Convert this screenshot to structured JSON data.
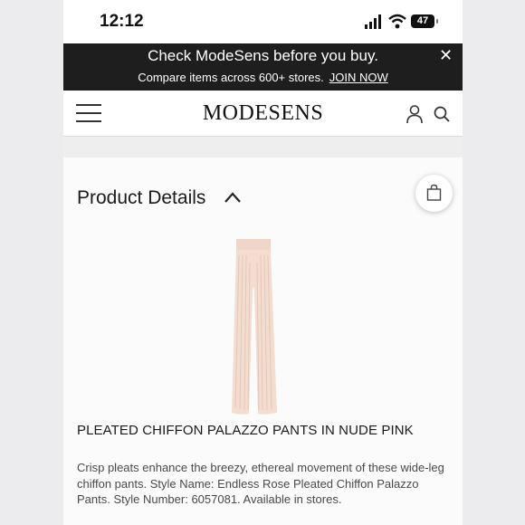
{
  "status_bar": {
    "time": "12:12",
    "battery": "47"
  },
  "promo": {
    "title": "Check ModeSens before you buy.",
    "subtitle": "Compare items across 600+ stores.",
    "link": "JOIN NOW",
    "close": "✕"
  },
  "nav": {
    "logo": "MODESENS"
  },
  "section": {
    "title": "Product Details"
  },
  "product": {
    "name": "PLEATED CHIFFON PALAZZO PANTS IN NUDE PINK",
    "description": "Crisp pleats enhance the breezy, ethereal movement of these wide-leg chiffon pants. Style Name: Endless Rose Pleated Chiffon Palazzo Pants. Style Number: 6057081. Available in stores."
  },
  "colors": {
    "promo_bg": "#1e1e1e",
    "pants_fill": "#f3ddd0",
    "text_dark": "#1a1a1a"
  },
  "icons": [
    "signal-icon",
    "wifi-icon",
    "battery-icon",
    "close-icon",
    "menu-icon",
    "user-icon",
    "search-icon",
    "chevron-up-icon",
    "bag-icon"
  ]
}
